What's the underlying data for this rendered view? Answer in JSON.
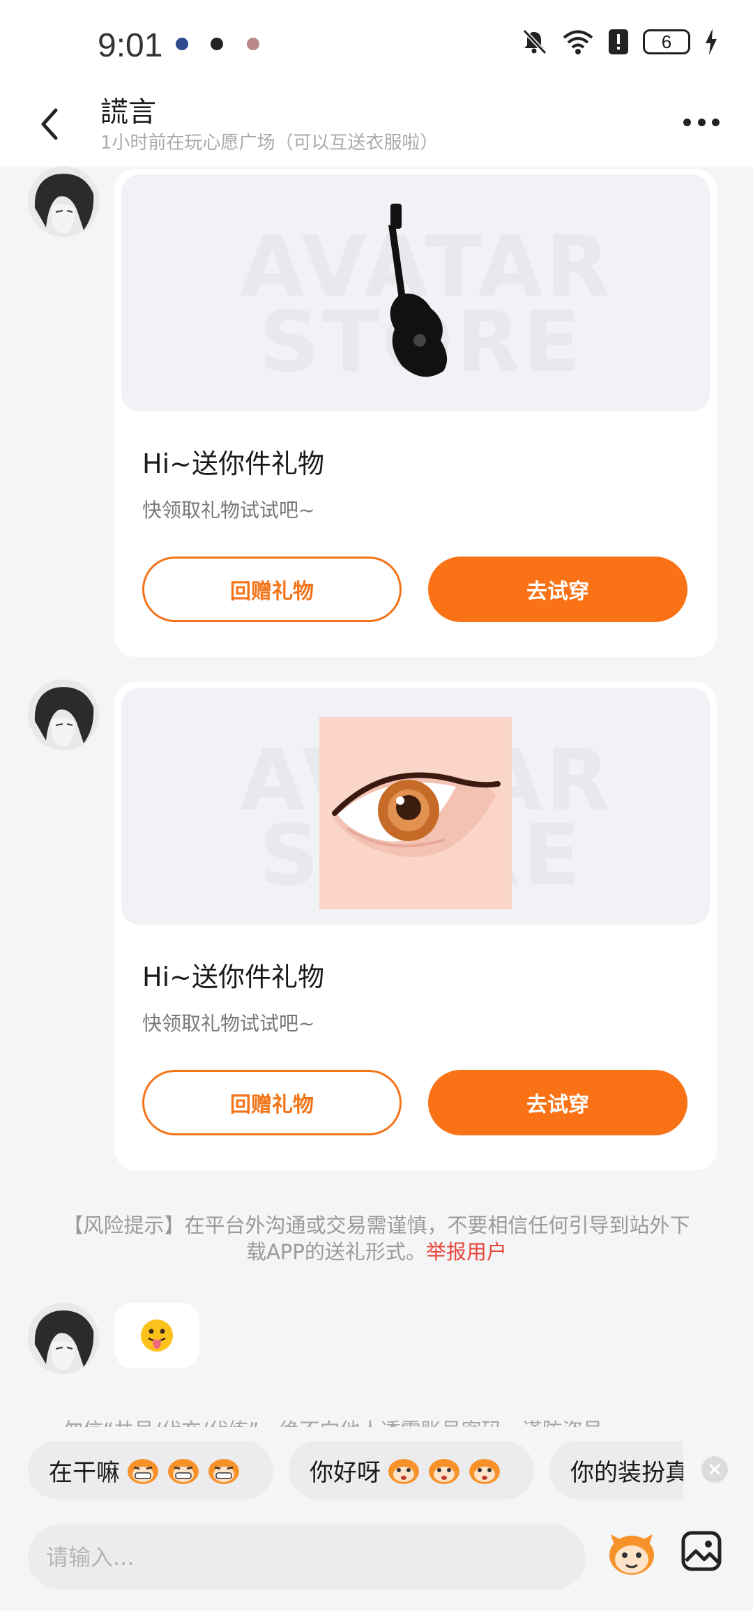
{
  "status_bar": {
    "time": "9:01",
    "battery": "6",
    "icons": [
      "notification-muted-icon",
      "wifi-icon",
      "alert-icon",
      "battery-icon",
      "charging-icon"
    ]
  },
  "header": {
    "title": "謊言",
    "subtitle": "1小时前在玩心愿广场（可以互送衣服啦）"
  },
  "messages": [
    {
      "type": "gift",
      "watermark": "AVATAR STORE",
      "item_icon": "guitar-icon",
      "title": "Hi~送你件礼物",
      "desc": "快领取礼物试试吧~",
      "return_label": "回赠礼物",
      "try_label": "去试穿"
    },
    {
      "type": "gift",
      "watermark": "AVATAR STORE",
      "item_icon": "eye-icon",
      "title": "Hi~送你件礼物",
      "desc": "快领取礼物试试吧~",
      "return_label": "回赠礼物",
      "try_label": "去试穿"
    },
    {
      "type": "emoji",
      "emoji": "😛"
    }
  ],
  "risk_tip": {
    "text": "【风险提示】在平台外沟通或交易需谨慎，不要相信任何引导到站外下载APP的送礼形式。",
    "link": "举报用户"
  },
  "cut_notice": "勿信“共号/代充/代练”，绝不向他人透露账号密码，谨防盗号",
  "quick_replies": [
    "在干嘛",
    "你好呀",
    "你的装扮真"
  ],
  "input": {
    "placeholder": "请输入..."
  },
  "colors": {
    "accent": "#f97316",
    "link": "#e8473d",
    "background": "#f4f5f7"
  }
}
